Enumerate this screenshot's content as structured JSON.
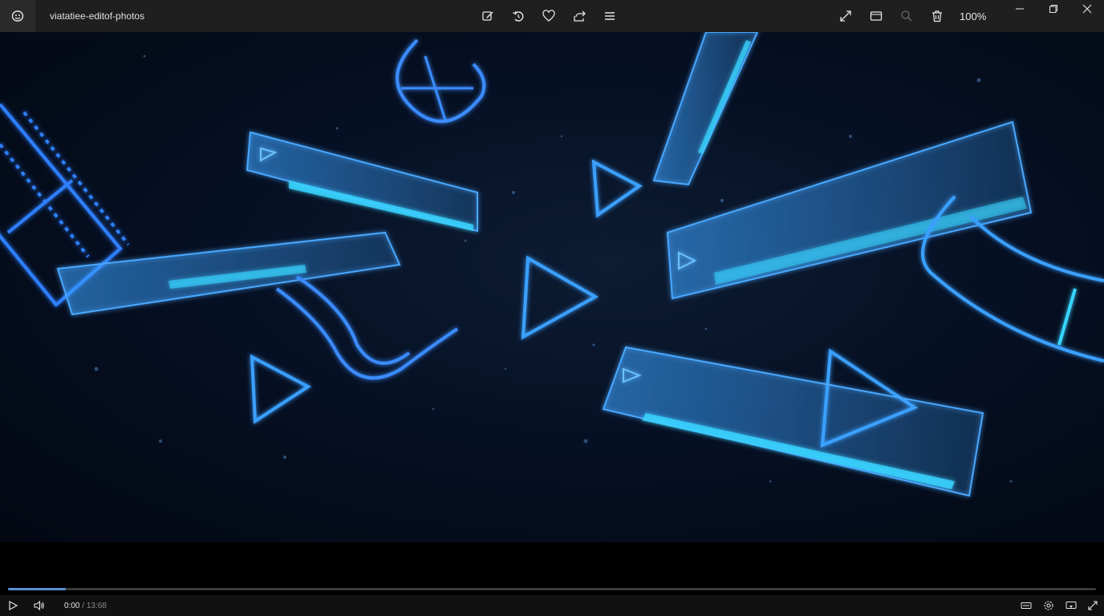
{
  "window": {
    "title": "viatatiee-editof-photos",
    "zoom": "100%"
  },
  "toolbar": {
    "center": [
      "edit-icon",
      "rotate-icon",
      "heart-icon",
      "share-icon",
      "menu-icon"
    ],
    "right": [
      "expand-icon",
      "slideshow-icon",
      "search-icon",
      "trash-icon"
    ]
  },
  "window_controls": [
    "minimize-icon",
    "restore-icon",
    "close-icon"
  ],
  "player": {
    "current_time": "0:00",
    "separator": " / ",
    "total_time": "13:68",
    "progress": 0.053,
    "controls_left": [
      "play-icon",
      "volume-icon"
    ],
    "controls_right": [
      "captions-icon",
      "settings-icon",
      "cast-icon",
      "fullscreen-icon"
    ]
  },
  "colors": {
    "titlebar_bg": "#1f1f1f",
    "accent_blue": "#3aa0ff",
    "glow_cyan": "#39d5ff",
    "progress_fill": "#5a8fd6"
  }
}
